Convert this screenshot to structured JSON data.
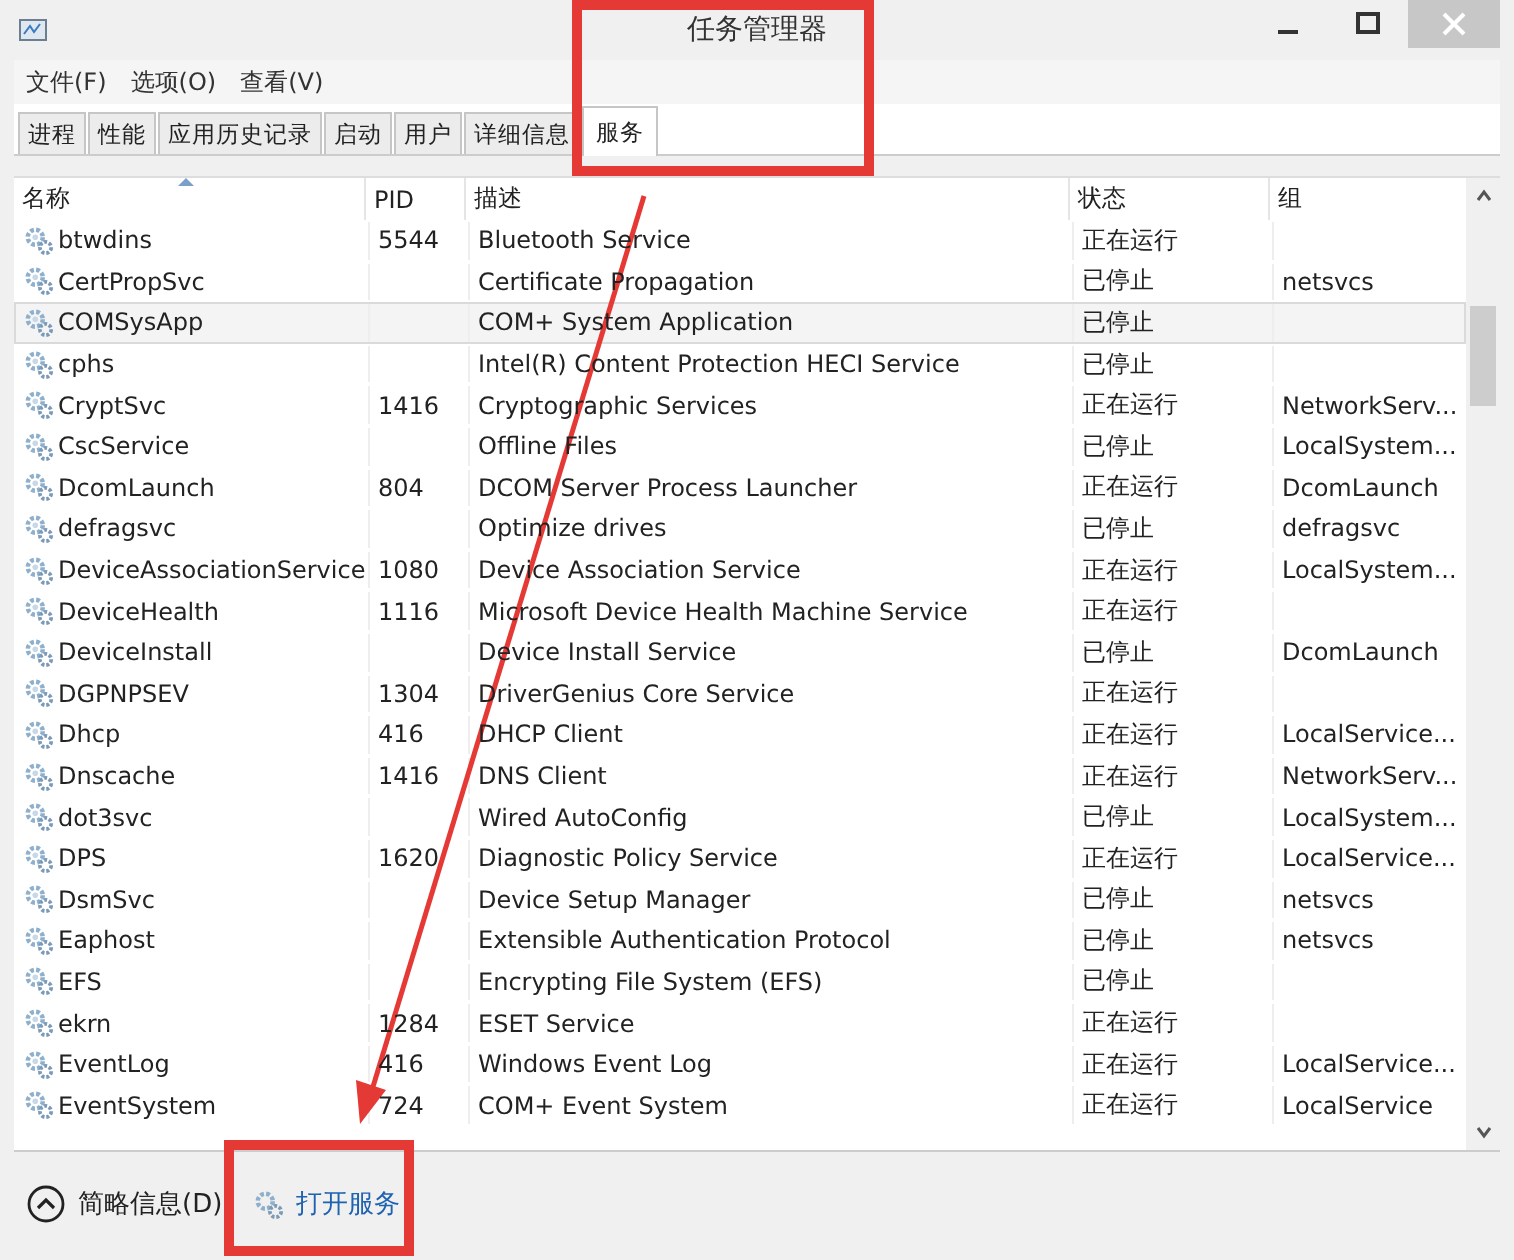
{
  "window": {
    "title": "任务管理器"
  },
  "menu": [
    "文件(F)",
    "选项(O)",
    "查看(V)"
  ],
  "tabs": [
    {
      "label": "进程",
      "selected": false
    },
    {
      "label": "性能",
      "selected": false
    },
    {
      "label": "应用历史记录",
      "selected": false
    },
    {
      "label": "启动",
      "selected": false
    },
    {
      "label": "用户",
      "selected": false
    },
    {
      "label": "详细信息",
      "selected": false
    },
    {
      "label": "服务",
      "selected": true
    }
  ],
  "table": {
    "columns": [
      "名称",
      "PID",
      "描述",
      "状态",
      "组"
    ],
    "rows": [
      {
        "name": "btwdins",
        "pid": "5544",
        "description": "Bluetooth Service",
        "status": "正在运行",
        "group": "",
        "selected": false
      },
      {
        "name": "CertPropSvc",
        "pid": "",
        "description": "Certificate Propagation",
        "status": "已停止",
        "group": "netsvcs",
        "selected": false
      },
      {
        "name": "COMSysApp",
        "pid": "",
        "description": "COM+ System Application",
        "status": "已停止",
        "group": "",
        "selected": true
      },
      {
        "name": "cphs",
        "pid": "",
        "description": "Intel(R) Content Protection HECI Service",
        "status": "已停止",
        "group": "",
        "selected": false
      },
      {
        "name": "CryptSvc",
        "pid": "1416",
        "description": "Cryptographic Services",
        "status": "正在运行",
        "group": "NetworkServ...",
        "selected": false
      },
      {
        "name": "CscService",
        "pid": "",
        "description": "Offline Files",
        "status": "已停止",
        "group": "LocalSystem...",
        "selected": false
      },
      {
        "name": "DcomLaunch",
        "pid": "804",
        "description": "DCOM Server Process Launcher",
        "status": "正在运行",
        "group": "DcomLaunch",
        "selected": false
      },
      {
        "name": "defragsvc",
        "pid": "",
        "description": "Optimize drives",
        "status": "已停止",
        "group": "defragsvc",
        "selected": false
      },
      {
        "name": "DeviceAssociationService",
        "pid": "1080",
        "description": "Device Association Service",
        "status": "正在运行",
        "group": "LocalSystem...",
        "selected": false
      },
      {
        "name": "DeviceHealth",
        "pid": "1116",
        "description": "Microsoft Device Health Machine Service",
        "status": "正在运行",
        "group": "",
        "selected": false
      },
      {
        "name": "DeviceInstall",
        "pid": "",
        "description": "Device Install Service",
        "status": "已停止",
        "group": "DcomLaunch",
        "selected": false
      },
      {
        "name": "DGPNPSEV",
        "pid": "1304",
        "description": "DriverGenius Core Service",
        "status": "正在运行",
        "group": "",
        "selected": false
      },
      {
        "name": "Dhcp",
        "pid": "416",
        "description": "DHCP Client",
        "status": "正在运行",
        "group": "LocalService...",
        "selected": false
      },
      {
        "name": "Dnscache",
        "pid": "1416",
        "description": "DNS Client",
        "status": "正在运行",
        "group": "NetworkServ...",
        "selected": false
      },
      {
        "name": "dot3svc",
        "pid": "",
        "description": "Wired AutoConfig",
        "status": "已停止",
        "group": "LocalSystem...",
        "selected": false
      },
      {
        "name": "DPS",
        "pid": "1620",
        "description": "Diagnostic Policy Service",
        "status": "正在运行",
        "group": "LocalService...",
        "selected": false
      },
      {
        "name": "DsmSvc",
        "pid": "",
        "description": "Device Setup Manager",
        "status": "已停止",
        "group": "netsvcs",
        "selected": false
      },
      {
        "name": "Eaphost",
        "pid": "",
        "description": "Extensible Authentication Protocol",
        "status": "已停止",
        "group": "netsvcs",
        "selected": false
      },
      {
        "name": "EFS",
        "pid": "",
        "description": "Encrypting File System (EFS)",
        "status": "已停止",
        "group": "",
        "selected": false
      },
      {
        "name": "ekrn",
        "pid": "1284",
        "description": "ESET Service",
        "status": "正在运行",
        "group": "",
        "selected": false
      },
      {
        "name": "EventLog",
        "pid": "416",
        "description": "Windows Event Log",
        "status": "正在运行",
        "group": "LocalService...",
        "selected": false
      },
      {
        "name": "EventSystem",
        "pid": "724",
        "description": "COM+ Event System",
        "status": "正在运行",
        "group": "LocalService",
        "selected": false
      }
    ]
  },
  "footer": {
    "details_toggle": "简略信息(D)",
    "open_services": "打开服务"
  }
}
